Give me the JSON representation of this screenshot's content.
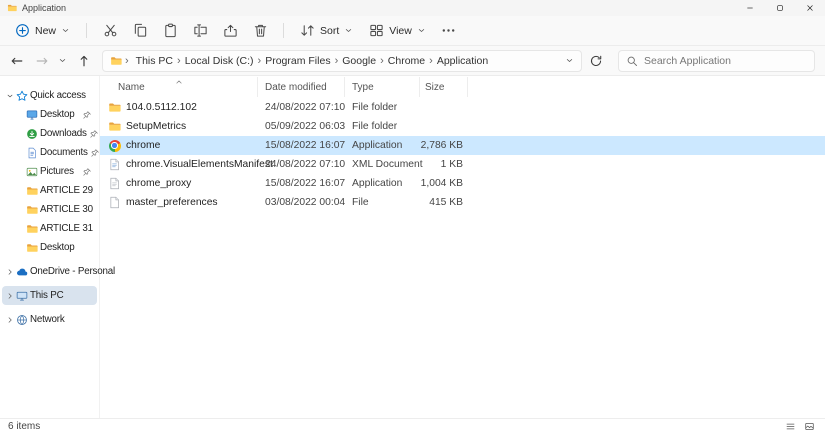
{
  "titlebar": {
    "title": "Application"
  },
  "toolbar": {
    "new_label": "New",
    "actions": [
      "cut",
      "copy",
      "paste",
      "rename",
      "share",
      "delete"
    ],
    "sort_label": "Sort",
    "view_label": "View"
  },
  "navbar": {
    "breadcrumb": [
      "This PC",
      "Local Disk (C:)",
      "Program Files",
      "Google",
      "Chrome",
      "Application"
    ],
    "search_placeholder": "Search Application"
  },
  "sidebar": {
    "items": [
      {
        "label": "Quick access",
        "icon": "star",
        "chevron": "down",
        "level": 0,
        "pinned": false,
        "selected": false
      },
      {
        "label": "Desktop",
        "icon": "desktop",
        "chevron": null,
        "level": 1,
        "pinned": true,
        "selected": false
      },
      {
        "label": "Downloads",
        "icon": "downloads",
        "chevron": null,
        "level": 1,
        "pinned": true,
        "selected": false
      },
      {
        "label": "Documents",
        "icon": "documents",
        "chevron": null,
        "level": 1,
        "pinned": true,
        "selected": false
      },
      {
        "label": "Pictures",
        "icon": "pictures",
        "chevron": null,
        "level": 1,
        "pinned": true,
        "selected": false
      },
      {
        "label": "ARTICLE 29",
        "icon": "folder",
        "chevron": null,
        "level": 1,
        "pinned": false,
        "selected": false
      },
      {
        "label": "ARTICLE 30",
        "icon": "folder",
        "chevron": null,
        "level": 1,
        "pinned": false,
        "selected": false
      },
      {
        "label": "ARTICLE 31",
        "icon": "folder",
        "chevron": null,
        "level": 1,
        "pinned": false,
        "selected": false
      },
      {
        "label": "Desktop",
        "icon": "folder",
        "chevron": null,
        "level": 1,
        "pinned": false,
        "selected": false
      },
      {
        "label": "OneDrive - Personal",
        "icon": "cloud",
        "chevron": "right",
        "level": 0,
        "pinned": false,
        "selected": false
      },
      {
        "label": "This PC",
        "icon": "computer",
        "chevron": "right",
        "level": 0,
        "pinned": false,
        "selected": true
      },
      {
        "label": "Network",
        "icon": "network",
        "chevron": "right",
        "level": 0,
        "pinned": false,
        "selected": false
      }
    ]
  },
  "filelist": {
    "columns": [
      {
        "label": "Name"
      },
      {
        "label": "Date modified"
      },
      {
        "label": "Type"
      },
      {
        "label": "Size"
      }
    ],
    "sorted_by": "Name",
    "sort_direction": "ascending",
    "rows": [
      {
        "name": "104.0.5112.102",
        "date_modified": "24/08/2022 07:10",
        "type": "File folder",
        "size": "",
        "icon": "folder",
        "selected": false
      },
      {
        "name": "SetupMetrics",
        "date_modified": "05/09/2022 06:03",
        "type": "File folder",
        "size": "",
        "icon": "folder",
        "selected": false
      },
      {
        "name": "chrome",
        "date_modified": "15/08/2022 16:07",
        "type": "Application",
        "size": "2,786 KB",
        "icon": "chrome",
        "selected": true
      },
      {
        "name": "chrome.VisualElementsManifest",
        "date_modified": "24/08/2022 07:10",
        "type": "XML Document",
        "size": "1 KB",
        "icon": "xml",
        "selected": false
      },
      {
        "name": "chrome_proxy",
        "date_modified": "15/08/2022 16:07",
        "type": "Application",
        "size": "1,004 KB",
        "icon": "app",
        "selected": false
      },
      {
        "name": "master_preferences",
        "date_modified": "03/08/2022 00:04",
        "type": "File",
        "size": "415 KB",
        "icon": "file",
        "selected": false
      }
    ]
  },
  "statusbar": {
    "items_count": "6 items",
    "view_toggles": [
      "details-view",
      "thumbnail-view"
    ]
  },
  "colors": {
    "selection_blue": "#cce8ff",
    "sidebar_selection": "#d9e3ee",
    "accent": "#0067c0",
    "folder_yellow": "#ffd25e"
  }
}
